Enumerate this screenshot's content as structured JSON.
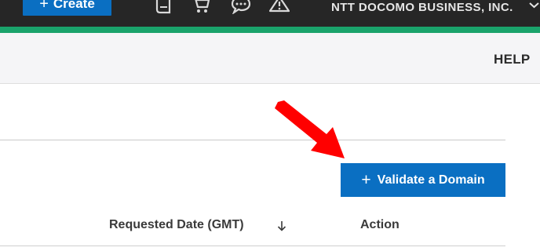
{
  "topbar": {
    "create_label": "Create",
    "icons": [
      "book-icon",
      "cart-icon",
      "chat-icon",
      "warning-icon"
    ],
    "company": "NTT DOCOMO BUSINESS, INC.",
    "bg_color": "#262626",
    "accent_line_color": "#1aa36b"
  },
  "subheader": {
    "help_label": "HELP"
  },
  "main": {
    "validate_label": "Validate a Domain",
    "columns": [
      {
        "label": "Requested Date (GMT)",
        "sort": "descending"
      },
      {
        "label": "Action"
      }
    ]
  },
  "annotation": {
    "arrow_color": "#ff0000"
  },
  "colors": {
    "primary_button": "#0a6fc2"
  }
}
